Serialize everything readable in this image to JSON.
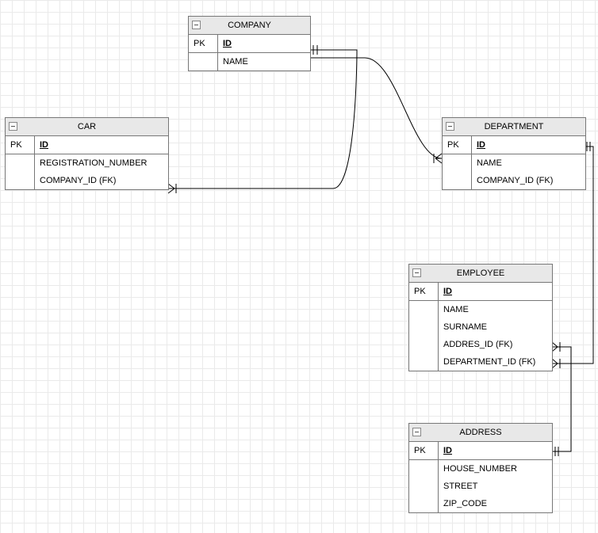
{
  "entities": {
    "company": {
      "title": "COMPANY",
      "pk_label": "PK",
      "pk": "ID",
      "attrs": [
        "NAME"
      ]
    },
    "car": {
      "title": "CAR",
      "pk_label": "PK",
      "pk": "ID",
      "attrs": [
        "REGISTRATION_NUMBER",
        "COMPANY_ID (FK)"
      ]
    },
    "department": {
      "title": "DEPARTMENT",
      "pk_label": "PK",
      "pk": "ID",
      "attrs": [
        "NAME",
        "COMPANY_ID (FK)"
      ]
    },
    "employee": {
      "title": "EMPLOYEE",
      "pk_label": "PK",
      "pk": "ID",
      "attrs": [
        "NAME",
        "SURNAME",
        "ADDRES_ID (FK)",
        "DEPARTMENT_ID (FK)"
      ]
    },
    "address": {
      "title": "ADDRESS",
      "pk_label": "PK",
      "pk": "ID",
      "attrs": [
        "HOUSE_NUMBER",
        "STREET",
        "ZIP_CODE"
      ]
    }
  },
  "relationships": [
    {
      "from": "company",
      "to": "car",
      "type": "one-to-many"
    },
    {
      "from": "company",
      "to": "department",
      "type": "one-to-many"
    },
    {
      "from": "department",
      "to": "employee",
      "type": "one-to-many"
    },
    {
      "from": "address",
      "to": "employee",
      "type": "one-to-many"
    }
  ]
}
